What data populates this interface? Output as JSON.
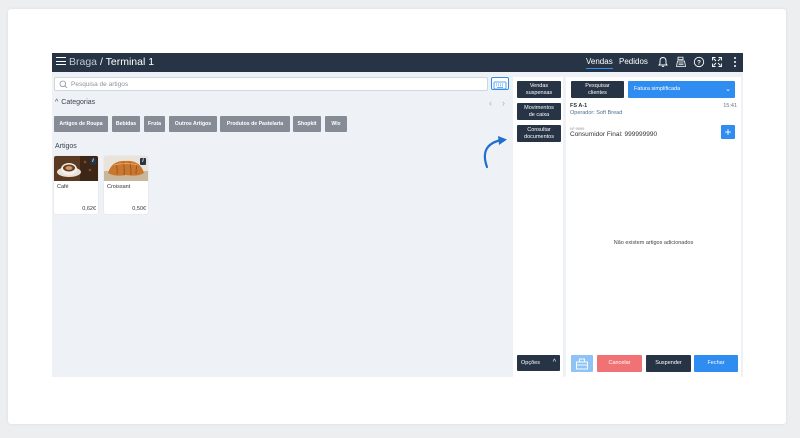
{
  "topbar": {
    "store": "Braga",
    "separator": "/",
    "terminal": "Terminal 1",
    "nav": [
      {
        "label": "Vendas",
        "active": true
      },
      {
        "label": "Pedidos",
        "active": false
      }
    ],
    "icons": [
      "bell-icon",
      "cash-register-icon",
      "help-icon",
      "fullscreen-icon",
      "more-icon"
    ]
  },
  "search": {
    "placeholder": "Pesquisa de artigos",
    "value": ""
  },
  "categories": {
    "heading": "Categorias",
    "items": [
      "Artigos de Roupa",
      "Bebidas",
      "Fruta",
      "Outros Artigos",
      "Produtos de Pastelaria",
      "Shopkit",
      "Wix"
    ]
  },
  "articles": {
    "heading": "Artigos",
    "items": [
      {
        "name": "Café",
        "price": "0,62€",
        "info": "i"
      },
      {
        "name": "Croissant",
        "price": "0,50€",
        "info": "i"
      }
    ]
  },
  "actions": {
    "suspended": [
      "Vendas",
      "suspensas"
    ],
    "cash": [
      "Movimentos",
      "de caixa"
    ],
    "consult": [
      "Consultar",
      "documentos"
    ],
    "options": "Opções"
  },
  "document": {
    "search_clients": [
      "Pesquisar",
      "clientes"
    ],
    "doc_type": "Fatura simplificada",
    "doc_id": "FS A-1",
    "time": "15:41",
    "operator": "Operador: Soft Bread",
    "n_label": "Nº 9999",
    "customer": "Consumidor Final: 999999990",
    "empty_message": "Não existem artigos adicionados",
    "buttons": {
      "cancel": "Cancelar",
      "suspend": "Suspender",
      "close": "Fechar"
    }
  },
  "colors": {
    "topbar": "#273445",
    "accent": "#2f8cf0",
    "category": "#858c96",
    "cancel": "#f07275",
    "drawer": "#8ec3f5"
  }
}
